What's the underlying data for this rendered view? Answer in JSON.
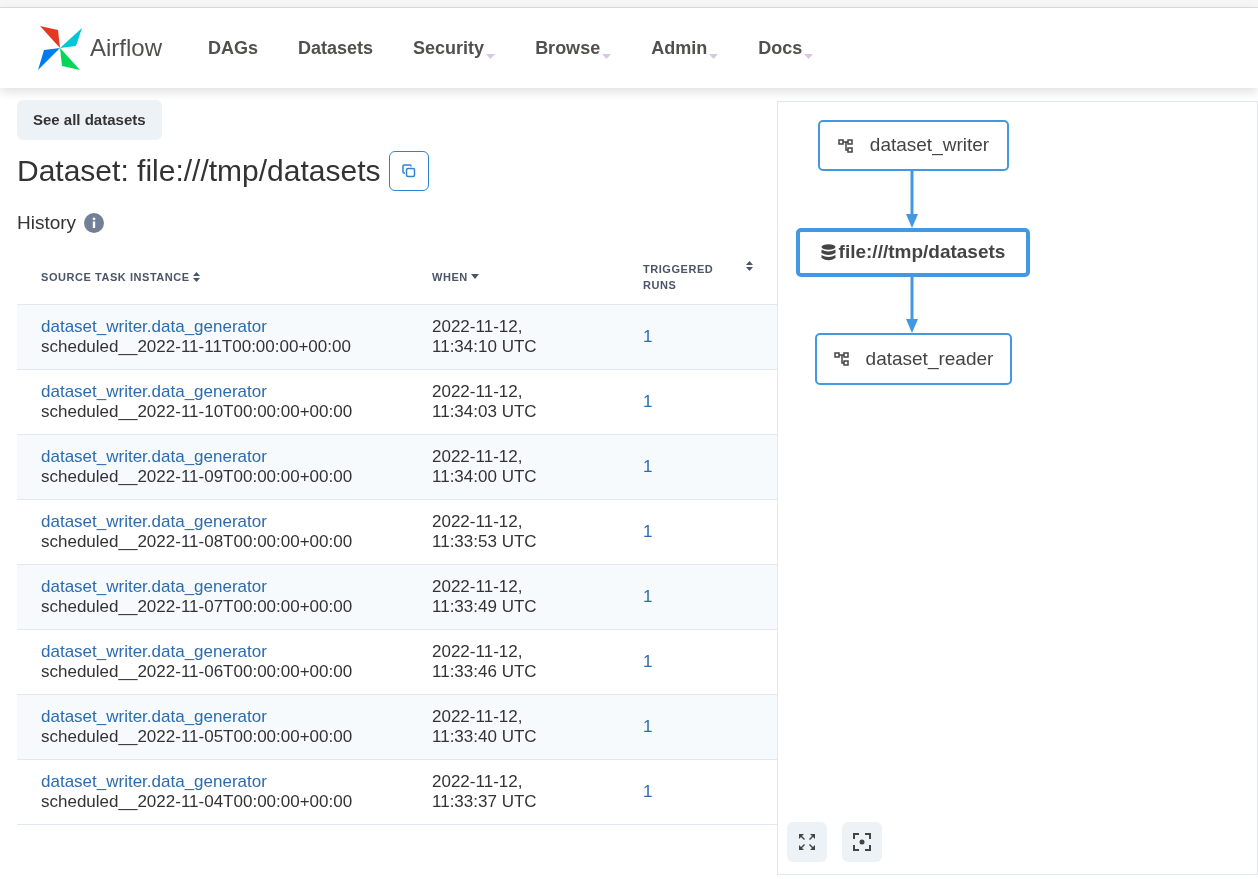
{
  "navbar": {
    "brand": "Airflow",
    "items": [
      {
        "label": "DAGs",
        "dropdown": false
      },
      {
        "label": "Datasets",
        "dropdown": false
      },
      {
        "label": "Security",
        "dropdown": true
      },
      {
        "label": "Browse",
        "dropdown": true
      },
      {
        "label": "Admin",
        "dropdown": true
      },
      {
        "label": "Docs",
        "dropdown": true
      }
    ]
  },
  "back_button": "See all datasets",
  "title": "Dataset: file:///tmp/datasets",
  "history": {
    "label": "History",
    "table": {
      "columns": [
        {
          "label": "SOURCE TASK INSTANCE",
          "sorted": false
        },
        {
          "label": "WHEN",
          "sorted": true
        },
        {
          "label": "TRIGGERED RUNS",
          "sorted": false
        }
      ],
      "rows": [
        {
          "task": "dataset_writer.data_generator",
          "run": "scheduled__2022-11-11T00:00:00+00:00",
          "when": "2022-11-12, 11:34:10 UTC",
          "triggered_runs": "1"
        },
        {
          "task": "dataset_writer.data_generator",
          "run": "scheduled__2022-11-10T00:00:00+00:00",
          "when": "2022-11-12, 11:34:03 UTC",
          "triggered_runs": "1"
        },
        {
          "task": "dataset_writer.data_generator",
          "run": "scheduled__2022-11-09T00:00:00+00:00",
          "when": "2022-11-12, 11:34:00 UTC",
          "triggered_runs": "1"
        },
        {
          "task": "dataset_writer.data_generator",
          "run": "scheduled__2022-11-08T00:00:00+00:00",
          "when": "2022-11-12, 11:33:53 UTC",
          "triggered_runs": "1"
        },
        {
          "task": "dataset_writer.data_generator",
          "run": "scheduled__2022-11-07T00:00:00+00:00",
          "when": "2022-11-12, 11:33:49 UTC",
          "triggered_runs": "1"
        },
        {
          "task": "dataset_writer.data_generator",
          "run": "scheduled__2022-11-06T00:00:00+00:00",
          "when": "2022-11-12, 11:33:46 UTC",
          "triggered_runs": "1"
        },
        {
          "task": "dataset_writer.data_generator",
          "run": "scheduled__2022-11-05T00:00:00+00:00",
          "when": "2022-11-12, 11:33:40 UTC",
          "triggered_runs": "1"
        },
        {
          "task": "dataset_writer.data_generator",
          "run": "scheduled__2022-11-04T00:00:00+00:00",
          "when": "2022-11-12, 11:33:37 UTC",
          "triggered_runs": "1"
        }
      ]
    }
  },
  "graph": {
    "nodes": [
      {
        "kind": "dag",
        "label": "dataset_writer",
        "selected": false
      },
      {
        "kind": "dataset",
        "label": "file:///tmp/datasets",
        "selected": true
      },
      {
        "kind": "dag",
        "label": "dataset_reader",
        "selected": false
      }
    ]
  }
}
